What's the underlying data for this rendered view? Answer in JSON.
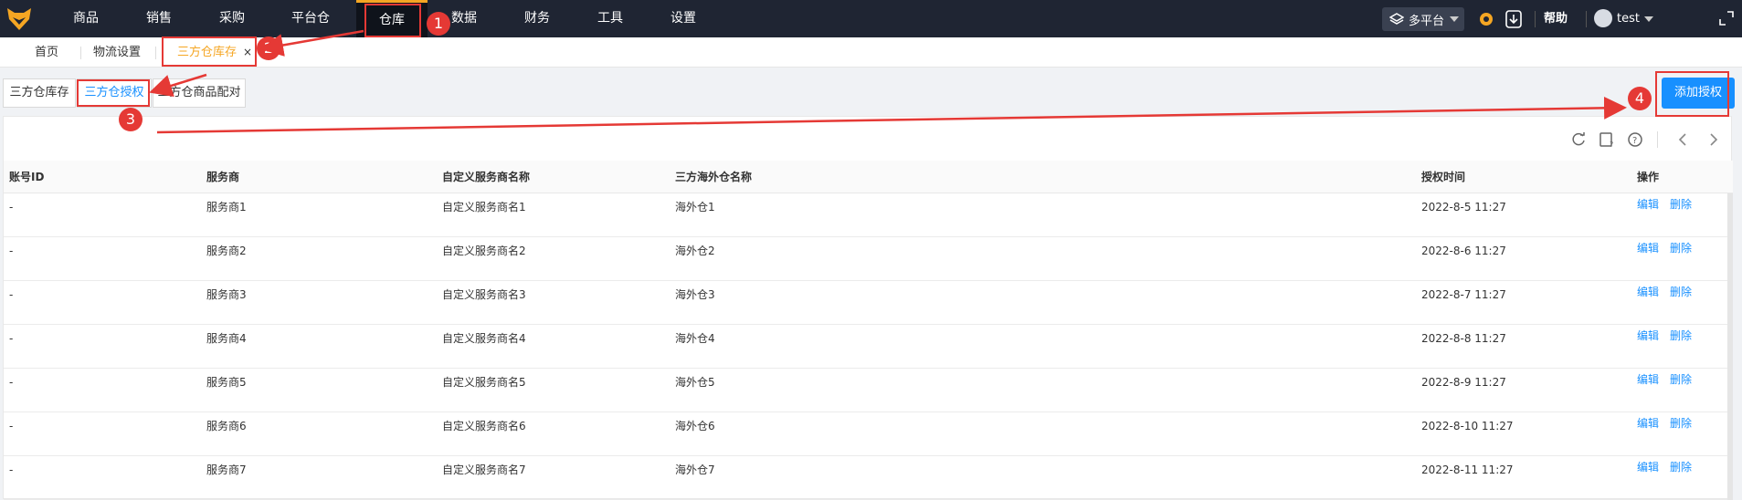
{
  "nav": {
    "items": [
      "商品",
      "销售",
      "采购",
      "平台仓",
      "仓库",
      "数据",
      "财务",
      "工具",
      "设置"
    ],
    "platform_label": "多平台",
    "help_label": "帮助",
    "user_name": "test"
  },
  "page_tabs": {
    "home": "首页",
    "logistics": "物流设置",
    "current": "三方仓库存",
    "close": "×"
  },
  "sub_tabs": [
    "三方仓库存",
    "三方仓授权",
    "三方仓商品配对"
  ],
  "add_button": "添加授权",
  "table": {
    "headers": [
      "账号ID",
      "服务商",
      "自定义服务商名称",
      "三方海外仓名称",
      "授权时间",
      "操作"
    ],
    "rows": [
      {
        "id": "-",
        "provider": "服务商1",
        "custom": "自定义服务商名1",
        "warehouse": "海外仓1",
        "time": "2022-8-5 11:27"
      },
      {
        "id": "-",
        "provider": "服务商2",
        "custom": "自定义服务商名2",
        "warehouse": "海外仓2",
        "time": "2022-8-6 11:27"
      },
      {
        "id": "-",
        "provider": "服务商3",
        "custom": "自定义服务商名3",
        "warehouse": "海外仓3",
        "time": "2022-8-7 11:27"
      },
      {
        "id": "-",
        "provider": "服务商4",
        "custom": "自定义服务商名4",
        "warehouse": "海外仓4",
        "time": "2022-8-8 11:27"
      },
      {
        "id": "-",
        "provider": "服务商5",
        "custom": "自定义服务商名5",
        "warehouse": "海外仓5",
        "time": "2022-8-9 11:27"
      },
      {
        "id": "-",
        "provider": "服务商6",
        "custom": "自定义服务商名6",
        "warehouse": "海外仓6",
        "time": "2022-8-10 11:27"
      },
      {
        "id": "-",
        "provider": "服务商7",
        "custom": "自定义服务商名7",
        "warehouse": "海外仓7",
        "time": "2022-8-11 11:27"
      }
    ],
    "edit_label": "编辑",
    "delete_label": "删除"
  },
  "annotations": [
    "1",
    "2",
    "3",
    "4"
  ],
  "colors": {
    "accent": "#1890ff",
    "nav_bg": "#1f2533",
    "highlight": "#f5a623",
    "annotation": "#e53935"
  }
}
